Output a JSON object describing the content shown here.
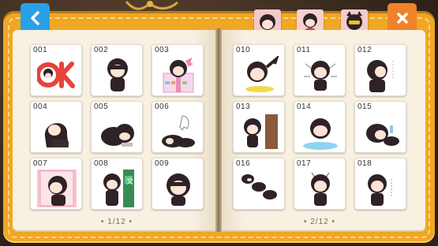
{
  "colors": {
    "cover": "#f0a726",
    "page": "#f8f1e2",
    "back_button": "#2aa0e6",
    "close_button": "#f0832a",
    "hair": "#2e2226",
    "ok_red": "#e6433d"
  },
  "buttons": {
    "back_icon": "chevron-left-icon",
    "close_icon": "close-icon"
  },
  "left_page": {
    "cards": [
      {
        "num": "001",
        "label": "OK"
      },
      {
        "num": "002"
      },
      {
        "num": "003"
      },
      {
        "num": "004"
      },
      {
        "num": "005"
      },
      {
        "num": "006"
      },
      {
        "num": "007"
      },
      {
        "num": "008",
        "label": "文"
      },
      {
        "num": "009"
      }
    ],
    "pager": "• 1/12 •"
  },
  "right_page": {
    "cards": [
      {
        "num": "010"
      },
      {
        "num": "011"
      },
      {
        "num": "012"
      },
      {
        "num": "013"
      },
      {
        "num": "014"
      },
      {
        "num": "015"
      },
      {
        "num": "016"
      },
      {
        "num": "017"
      },
      {
        "num": "018"
      }
    ],
    "pager": "• 2/12 •"
  }
}
